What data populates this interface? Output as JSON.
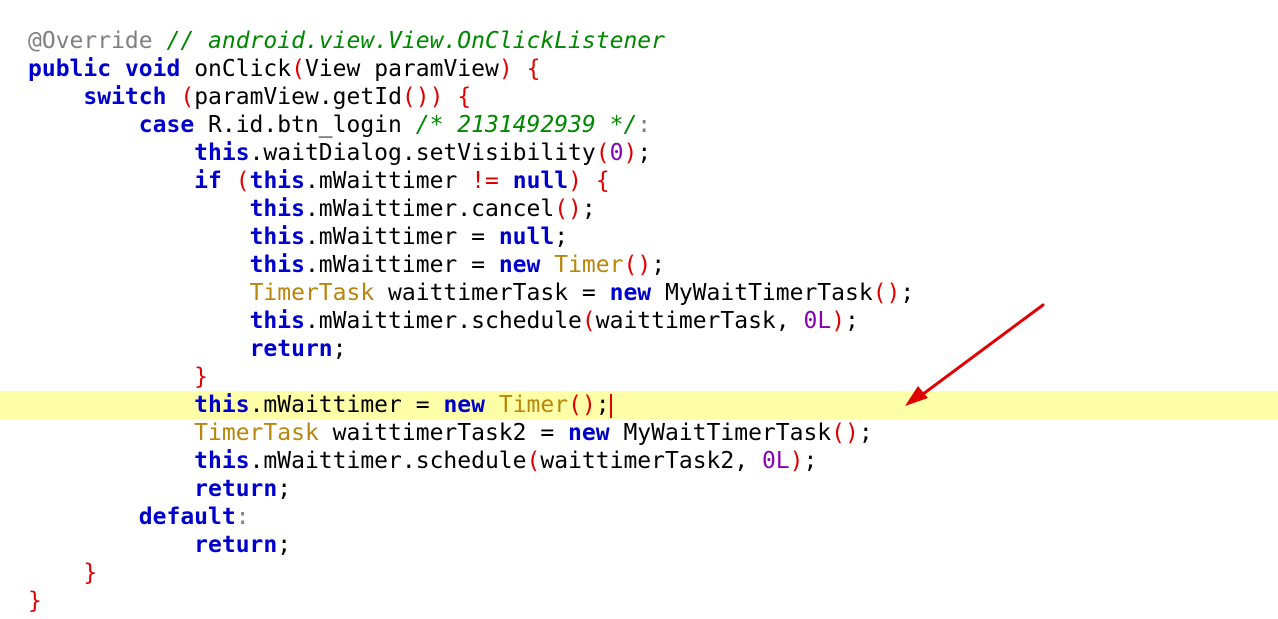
{
  "code_lines": [
    [
      {
        "t": "@Override",
        "c": "an"
      },
      {
        "t": " "
      },
      {
        "t": "// android.view.View.OnClickListener",
        "c": "cm"
      }
    ],
    [
      {
        "t": "public",
        "c": "kw"
      },
      {
        "t": " "
      },
      {
        "t": "void",
        "c": "kw"
      },
      {
        "t": " onClick"
      },
      {
        "t": "(",
        "c": "br"
      },
      {
        "t": "View paramView"
      },
      {
        "t": ")",
        "c": "br"
      },
      {
        "t": " "
      },
      {
        "t": "{",
        "c": "br"
      }
    ],
    [
      {
        "t": "    "
      },
      {
        "t": "switch",
        "c": "kw"
      },
      {
        "t": " "
      },
      {
        "t": "(",
        "c": "br"
      },
      {
        "t": "paramView.getId"
      },
      {
        "t": "())",
        "c": "br"
      },
      {
        "t": " "
      },
      {
        "t": "{",
        "c": "br"
      }
    ],
    [
      {
        "t": "        "
      },
      {
        "t": "case",
        "c": "kw"
      },
      {
        "t": " R.id.btn_login "
      },
      {
        "t": "/* 2131492939 */",
        "c": "cm"
      },
      {
        "t": ":",
        "c": "an"
      }
    ],
    [
      {
        "t": "            "
      },
      {
        "t": "this",
        "c": "kw"
      },
      {
        "t": ".waitDialog.setVisibility"
      },
      {
        "t": "(",
        "c": "br"
      },
      {
        "t": "0",
        "c": "nm"
      },
      {
        "t": ")",
        "c": "br"
      },
      {
        "t": ";"
      }
    ],
    [
      {
        "t": "            "
      },
      {
        "t": "if",
        "c": "kw"
      },
      {
        "t": " "
      },
      {
        "t": "(",
        "c": "br"
      },
      {
        "t": "this",
        "c": "kw"
      },
      {
        "t": ".mWaittimer "
      },
      {
        "t": "!=",
        "c": "br"
      },
      {
        "t": " "
      },
      {
        "t": "null",
        "c": "kw"
      },
      {
        "t": ")",
        "c": "br"
      },
      {
        "t": " "
      },
      {
        "t": "{",
        "c": "br"
      }
    ],
    [
      {
        "t": "                "
      },
      {
        "t": "this",
        "c": "kw"
      },
      {
        "t": ".mWaittimer.cancel"
      },
      {
        "t": "()",
        "c": "br"
      },
      {
        "t": ";"
      }
    ],
    [
      {
        "t": "                "
      },
      {
        "t": "this",
        "c": "kw"
      },
      {
        "t": ".mWaittimer = "
      },
      {
        "t": "null",
        "c": "kw"
      },
      {
        "t": ";"
      }
    ],
    [
      {
        "t": "                "
      },
      {
        "t": "this",
        "c": "kw"
      },
      {
        "t": ".mWaittimer = "
      },
      {
        "t": "new",
        "c": "kw"
      },
      {
        "t": " "
      },
      {
        "t": "Timer",
        "c": "ty"
      },
      {
        "t": "()",
        "c": "br"
      },
      {
        "t": ";"
      }
    ],
    [
      {
        "t": "                "
      },
      {
        "t": "TimerTask",
        "c": "ty"
      },
      {
        "t": " waittimerTask = "
      },
      {
        "t": "new",
        "c": "kw"
      },
      {
        "t": " MyWaitTimerTask"
      },
      {
        "t": "()",
        "c": "br"
      },
      {
        "t": ";"
      }
    ],
    [
      {
        "t": "                "
      },
      {
        "t": "this",
        "c": "kw"
      },
      {
        "t": ".mWaittimer.schedule"
      },
      {
        "t": "(",
        "c": "br"
      },
      {
        "t": "waittimerTask, "
      },
      {
        "t": "0L",
        "c": "nm"
      },
      {
        "t": ")",
        "c": "br"
      },
      {
        "t": ";"
      }
    ],
    [
      {
        "t": "                "
      },
      {
        "t": "return",
        "c": "kw"
      },
      {
        "t": ";"
      }
    ],
    [
      {
        "t": "            "
      },
      {
        "t": "}",
        "c": "br"
      }
    ],
    [
      {
        "t": "            "
      },
      {
        "t": "this",
        "c": "kw"
      },
      {
        "t": ".mWaittimer = "
      },
      {
        "t": "new",
        "c": "kw"
      },
      {
        "t": " "
      },
      {
        "t": "Timer",
        "c": "ty"
      },
      {
        "t": "()",
        "c": "br"
      },
      {
        "t": ";"
      }
    ],
    [
      {
        "t": "            "
      },
      {
        "t": "TimerTask",
        "c": "ty"
      },
      {
        "t": " waittimerTask2 = "
      },
      {
        "t": "new",
        "c": "kw"
      },
      {
        "t": " MyWaitTimerTask"
      },
      {
        "t": "()",
        "c": "br"
      },
      {
        "t": ";"
      }
    ],
    [
      {
        "t": "            "
      },
      {
        "t": "this",
        "c": "kw"
      },
      {
        "t": ".mWaittimer.schedule"
      },
      {
        "t": "(",
        "c": "br"
      },
      {
        "t": "waittimerTask2, "
      },
      {
        "t": "0L",
        "c": "nm"
      },
      {
        "t": ")",
        "c": "br"
      },
      {
        "t": ";"
      }
    ],
    [
      {
        "t": "            "
      },
      {
        "t": "return",
        "c": "kw"
      },
      {
        "t": ";"
      }
    ],
    [
      {
        "t": "        "
      },
      {
        "t": "default",
        "c": "kw"
      },
      {
        "t": ":",
        "c": "an"
      }
    ],
    [
      {
        "t": "            "
      },
      {
        "t": "return",
        "c": "kw"
      },
      {
        "t": ";"
      }
    ],
    [
      {
        "t": "    "
      },
      {
        "t": "}",
        "c": "br"
      }
    ],
    [
      {
        "t": "}",
        "c": "br"
      }
    ]
  ],
  "current_line": 14,
  "colors": {
    "keyword": "#0000cc",
    "bracket": "#e00000",
    "type": "#b8860b",
    "number": "#8a00b8",
    "comment": "#008800",
    "annotation": "#808080",
    "current_line_highlight": "#ffffa8",
    "caret": "#e00000",
    "arrow": "#e00000"
  },
  "annotation_arrow": {
    "icon": "arrow-icon",
    "points_to_line": 14
  }
}
